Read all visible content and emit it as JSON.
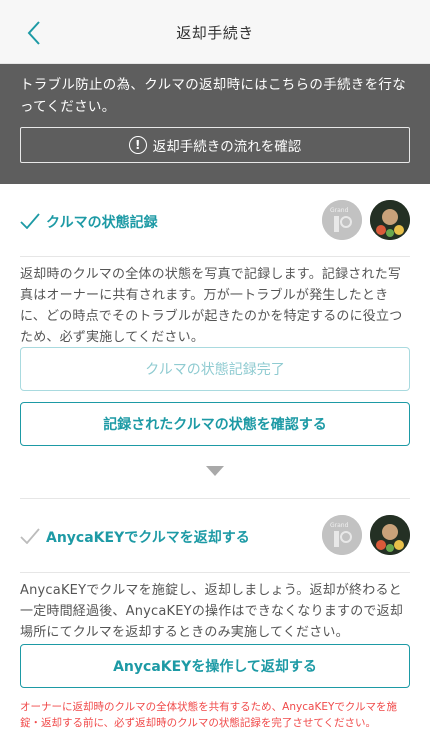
{
  "nav": {
    "title": "返却手続き"
  },
  "banner": {
    "text": "トラブル防止の為、クルマの返却時にはこちらの手続きを行なってください。",
    "flow_button_label": "返却手続きの流れを確認"
  },
  "section1": {
    "title": "クルマの状態記録",
    "description": "返却時のクルマの全体の状態を写真で記録します。記録された写真はオーナーに共有されます。万が一トラブルが発生したときに、どの時点でそのトラブルが起きたのかを特定するのに役立つため、必ず実施してください。",
    "complete_button_label": "クルマの状態記録完了",
    "confirm_button_label": "記録されたクルマの状態を確認する"
  },
  "section2": {
    "title": "AnycaKEYでクルマを返却する",
    "description": "AnycaKEYでクルマを施錠し、返却しましょう。返却が終わると一定時間経過後、AnycaKEYの操作はできなくなりますので返却場所にてクルマを返却するときのみ実施してください。",
    "operate_button_label": "AnycaKEYを操作して返却する"
  },
  "warning": "オーナーに返却時のクルマの全体状態を共有するため、AnycaKEYでクルマを施錠・返却する前に、必ず返却時のクルマの状態記録を完了させてください。",
  "colors": {
    "accent": "#1d9aa5",
    "banner_bg": "#5e5e5e",
    "warning": "#f04a4a"
  }
}
